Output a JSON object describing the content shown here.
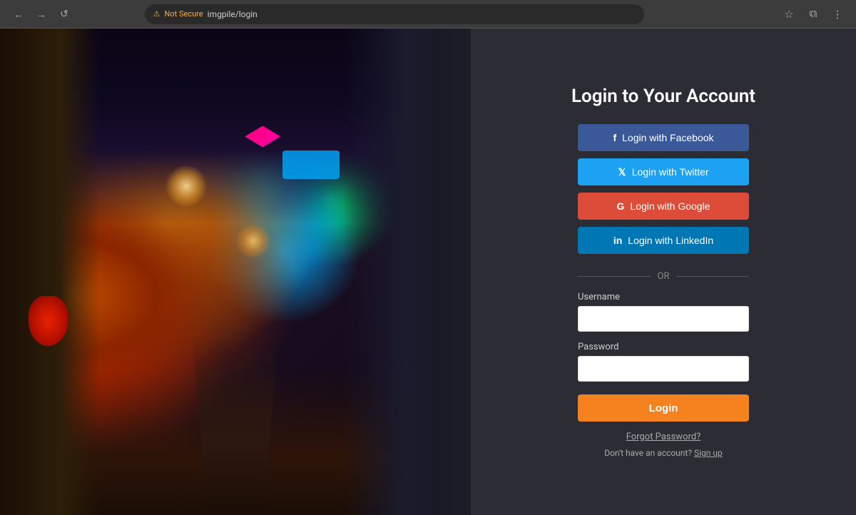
{
  "browser": {
    "url": "imgpile/login",
    "security_label": "Not Secure",
    "back_icon": "←",
    "forward_icon": "→",
    "reload_icon": "↺"
  },
  "login": {
    "title": "Login to Your Account",
    "facebook_btn": "Login with Facebook",
    "twitter_btn": "Login with Twitter",
    "google_btn": "Login with Google",
    "linkedin_btn": "Login with LinkedIn",
    "or_divider": "OR",
    "username_label": "Username",
    "password_label": "Password",
    "username_placeholder": "",
    "password_placeholder": "",
    "login_btn": "Login",
    "forgot_password": "Forgot Password?",
    "no_account_text": "Don't have an account?",
    "signup_link": "Sign up"
  }
}
